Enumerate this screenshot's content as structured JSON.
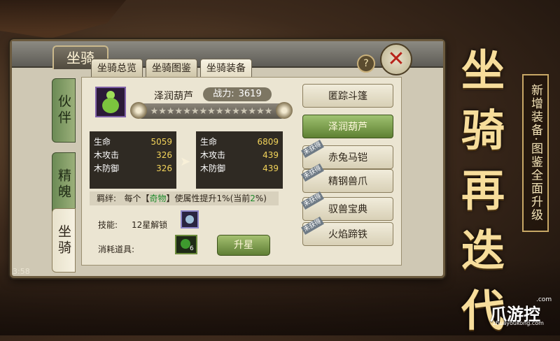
{
  "window": {
    "title": "坐骑",
    "help_label": "?",
    "close_label": "✕"
  },
  "sub_tabs": [
    "坐骑总览",
    "坐骑图鉴",
    "坐骑装备"
  ],
  "side_tabs": [
    "伙伴",
    "精魄",
    "坐骑"
  ],
  "item": {
    "name": "泽润葫芦",
    "power_label": "战力:",
    "power_value": "3619",
    "stars": "★★★★★★★★★★★★★★★",
    "star_count": 0,
    "star_max": 15
  },
  "stats_current": [
    {
      "label": "生命",
      "value": "5059"
    },
    {
      "label": "木攻击",
      "value": "326"
    },
    {
      "label": "木防御",
      "value": "326"
    }
  ],
  "stats_next": [
    {
      "label": "生命",
      "value": "6809"
    },
    {
      "label": "木攻击",
      "value": "439"
    },
    {
      "label": "木防御",
      "value": "439"
    }
  ],
  "arrow": "➤",
  "bond": {
    "label": "羁绊:",
    "text_a": "每个【",
    "highlight": "奇物",
    "text_b": "】使属性提升1%(当前",
    "current": "2",
    "text_c": "%)"
  },
  "skill": {
    "label": "技能:",
    "text": "12星解锁"
  },
  "consume": {
    "label": "消耗道具:",
    "count": "6"
  },
  "upgrade_button": "升星",
  "equip_list": [
    {
      "name": "匿踪斗篷",
      "locked": false,
      "selected": false
    },
    {
      "name": "泽润葫芦",
      "locked": false,
      "selected": true
    },
    {
      "name": "赤兔马铠",
      "locked": true,
      "selected": false
    },
    {
      "name": "精钢兽爪",
      "locked": true,
      "selected": false
    },
    {
      "name": "驭兽宝典",
      "locked": true,
      "selected": false
    },
    {
      "name": "火焰蹄铁",
      "locked": true,
      "selected": false
    }
  ],
  "lock_label": "未获得",
  "status_time": "3:58",
  "promo": {
    "title": "坐骑再迭代",
    "subtitle": "新增装备·图鉴全面升级"
  },
  "logo": {
    "brand": "爪游控",
    "suffix": ".com",
    "url": "zhuayoukong.com"
  },
  "colors": {
    "selected_item": "#7ea352",
    "stat_value": "#f2d35a",
    "bond_highlight": "#1d8a2a",
    "close_x": "#b8231a"
  }
}
